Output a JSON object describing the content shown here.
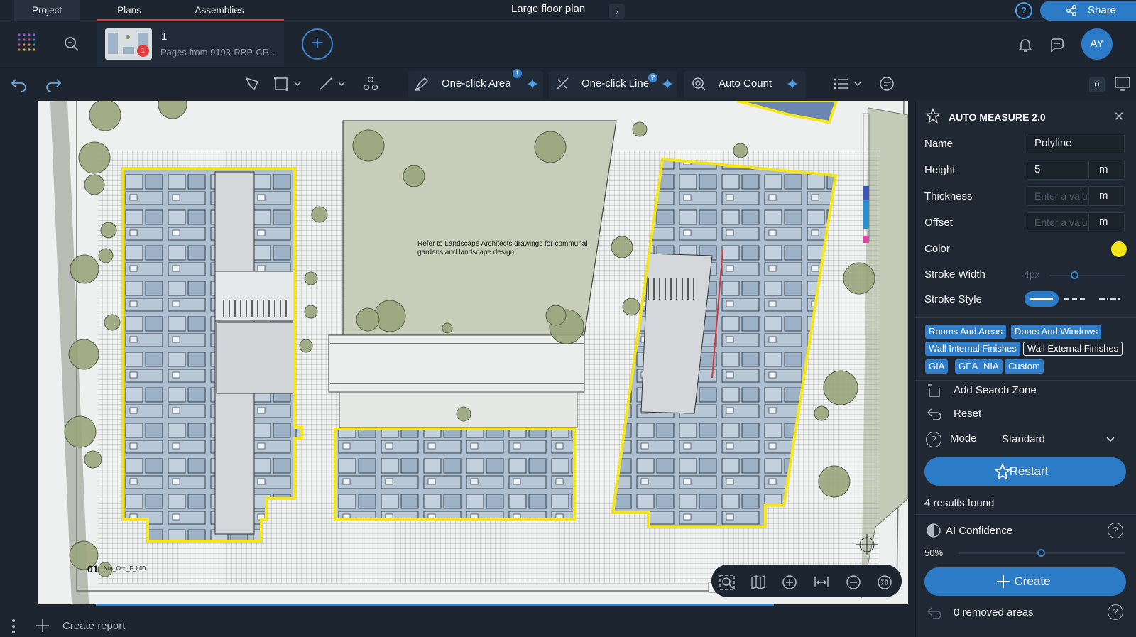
{
  "tabs": {
    "project": "Project",
    "plans": "Plans",
    "assemblies": "Assemblies"
  },
  "document": {
    "title": "Large floor plan"
  },
  "header": {
    "help": "?",
    "share": "Share",
    "avatar": "AY"
  },
  "page_card": {
    "number": "1",
    "subtitle": "Pages from 9193-RBP-CP...",
    "badge": "1"
  },
  "toolbar": {
    "one_click_area": "One-click Area",
    "one_click_line": "One-click Line",
    "auto_count": "Auto Count",
    "area_badge": "!",
    "line_badge": "?",
    "count": "0"
  },
  "canvas": {
    "landscape_note": "Refer to Landscape Architects drawings for communal gardens and landscape design",
    "drawing_label": "01",
    "drawing_sublabel": "NIA_Occ_F_L00"
  },
  "bottom": {
    "create_report": "Create report"
  },
  "panel": {
    "title": "AUTO MEASURE 2.0",
    "name_label": "Name",
    "name_value": "Polyline",
    "height_label": "Height",
    "height_value": "5",
    "height_unit": "m",
    "thickness_label": "Thickness",
    "thickness_placeholder": "Enter a value",
    "thickness_unit": "m",
    "offset_label": "Offset",
    "offset_placeholder": "Enter a value",
    "offset_unit": "m",
    "color_label": "Color",
    "color_value": "#f5e61a",
    "stroke_width_label": "Stroke Width",
    "stroke_width_value": "4px",
    "stroke_style_label": "Stroke Style",
    "chips": [
      "Rooms And Areas",
      "Doors And Windows",
      "Wall Internal Finishes",
      "Wall External Finishes",
      "GIA",
      "GEA",
      "NIA",
      "Custom"
    ],
    "add_search_zone": "Add Search Zone",
    "reset": "Reset",
    "mode_label": "Mode",
    "mode_value": "Standard",
    "restart": "Restart",
    "results": "4 results found",
    "ai_confidence_label": "AI Confidence",
    "ai_confidence_value": "50%",
    "ai_confidence_fraction": 0.5,
    "create": "Create",
    "removed_areas": "0 removed areas"
  },
  "colors": {
    "accent": "#2b7bc7",
    "highlight": "#f5e61a",
    "tab_underline": "#e23b3b"
  }
}
